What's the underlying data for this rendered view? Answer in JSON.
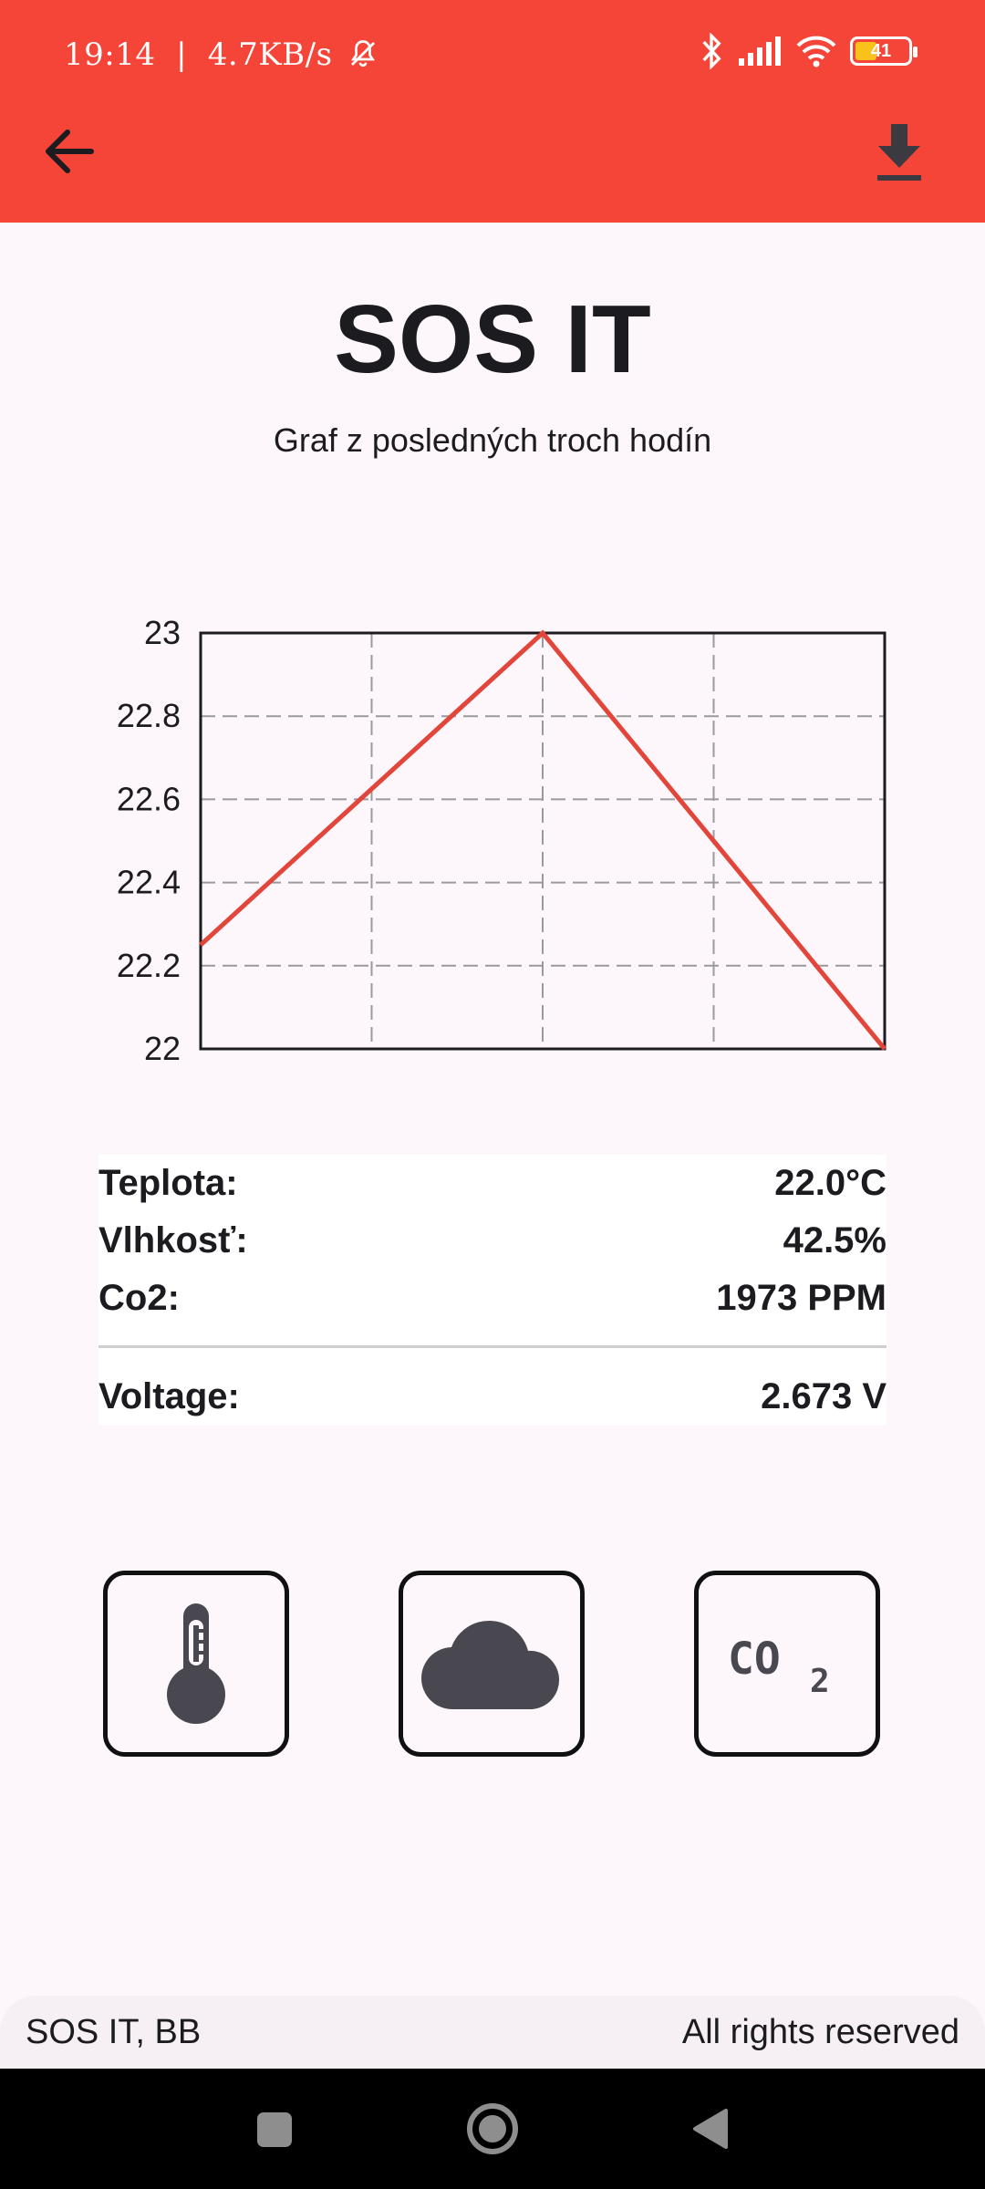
{
  "status_bar": {
    "time": "19:14",
    "speed": "4.7KB/s",
    "battery_level": "41",
    "battery_fraction": 0.41
  },
  "app_bar": {
    "color": "#f44538",
    "back_icon": "arrow-left-icon",
    "download_icon": "download-icon"
  },
  "header": {
    "title": "SOS IT",
    "subtitle": "Graf z posledných troch hodín"
  },
  "chart_data": {
    "type": "line",
    "x": [
      0,
      1,
      2,
      3,
      4
    ],
    "series": [
      {
        "values": [
          22.25,
          22.625,
          23.0,
          22.5,
          22.0
        ],
        "color": "#e2463b"
      }
    ],
    "ylim": [
      22,
      23
    ],
    "yticks": [
      "22",
      "22.2",
      "22.4",
      "22.6",
      "22.8",
      "23"
    ],
    "grid": true
  },
  "readings": {
    "temperature": {
      "label": "Teplota:",
      "value": "22.0°C"
    },
    "humidity": {
      "label": "Vlhkosť:",
      "value": "42.5%"
    },
    "co2": {
      "label": "Co2:",
      "value": "1973 PPM"
    },
    "voltage": {
      "label": "Voltage:",
      "value": "2.673 V"
    }
  },
  "sensor_buttons": [
    {
      "icon": "thermometer-icon"
    },
    {
      "icon": "cloud-icon"
    },
    {
      "icon": "co2-icon"
    }
  ],
  "footer": {
    "left": "SOS IT, BB",
    "right": "All rights reserved"
  },
  "nav": {
    "icons": [
      "recents-square-icon",
      "home-circle-icon",
      "back-triangle-icon"
    ]
  }
}
